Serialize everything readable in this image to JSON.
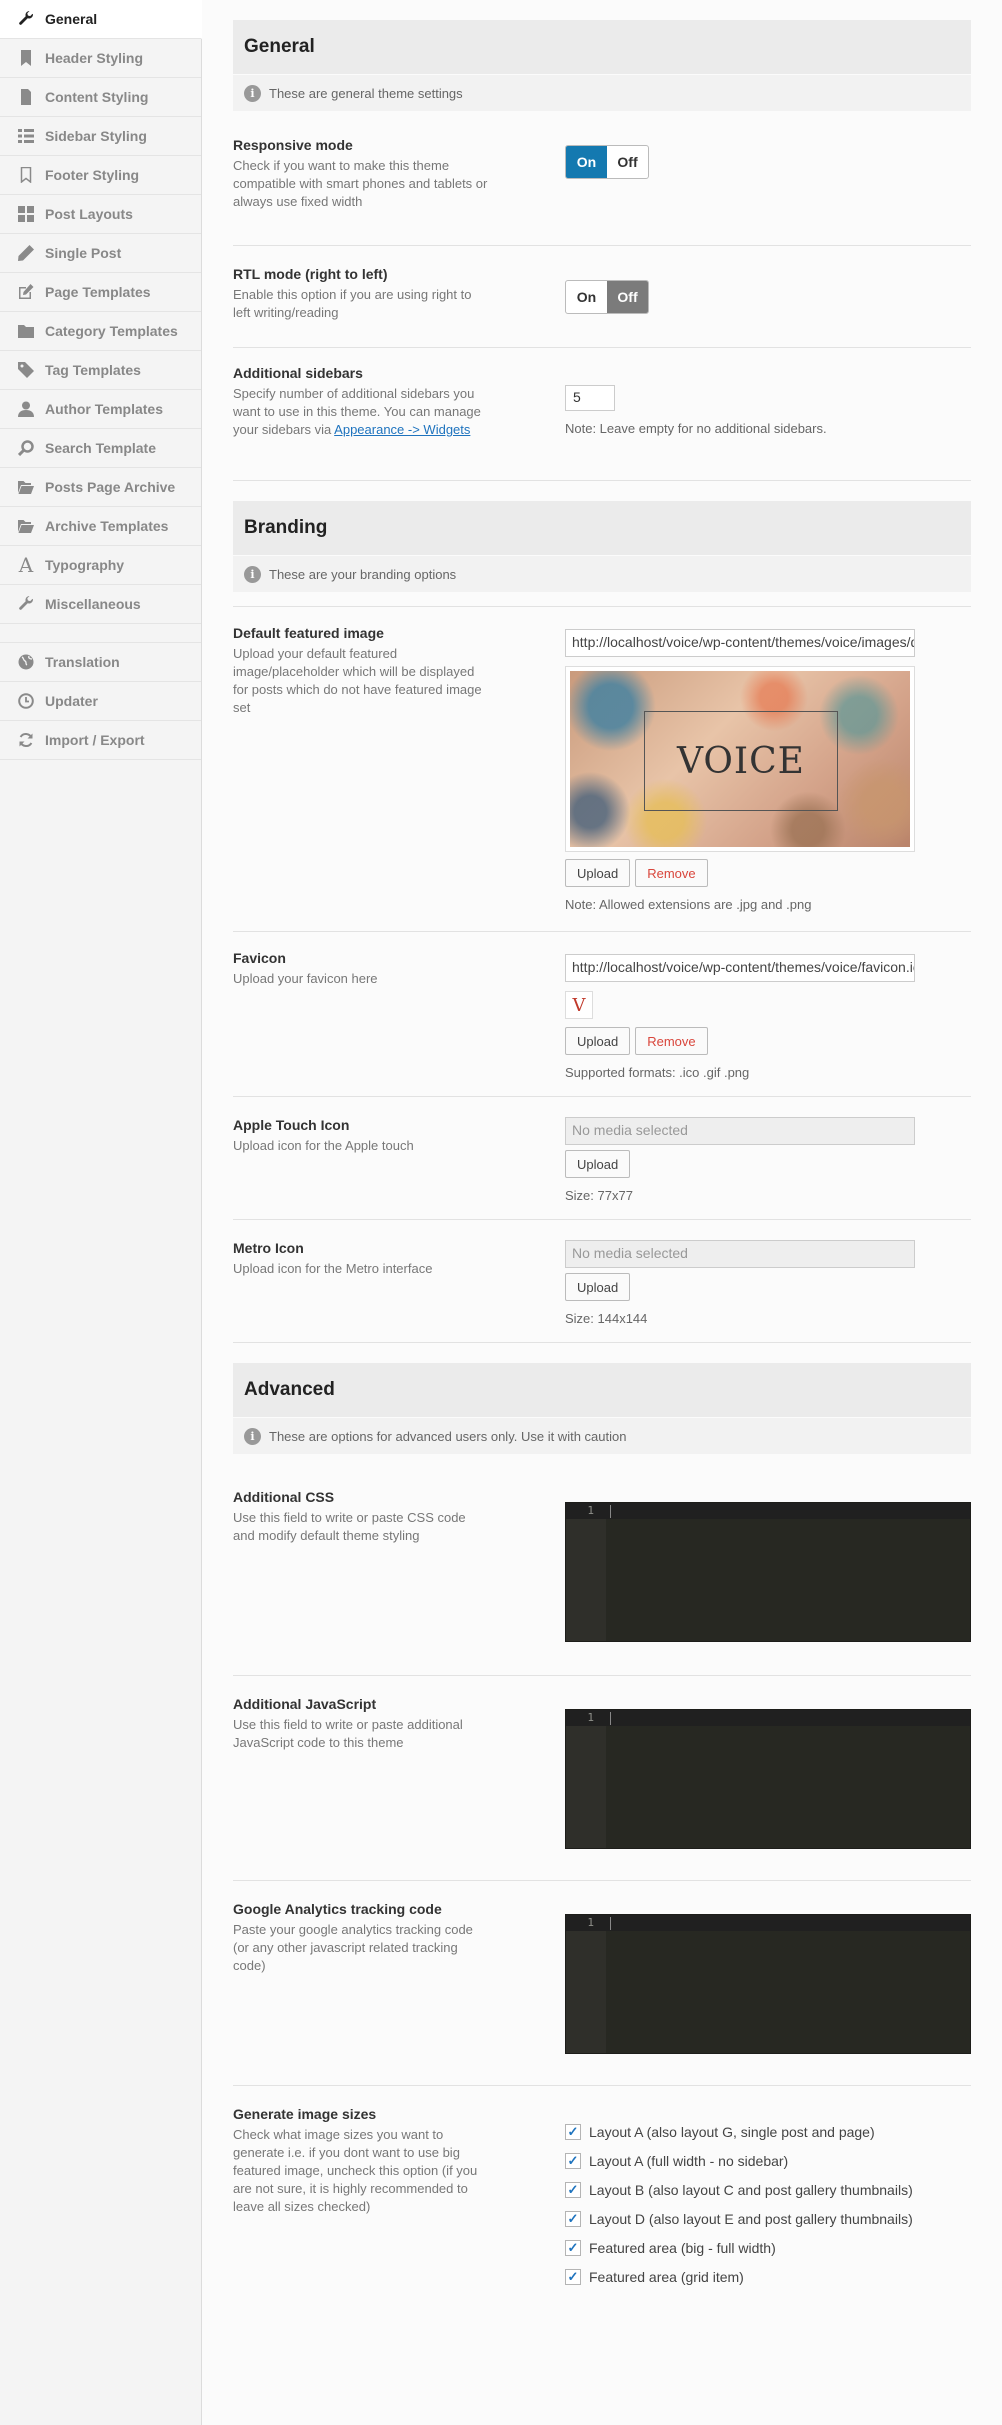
{
  "sidebar": {
    "items": [
      {
        "label": "General",
        "icon": "wrench-icon"
      },
      {
        "label": "Header Styling",
        "icon": "bookmark-icon"
      },
      {
        "label": "Content Styling",
        "icon": "document-icon"
      },
      {
        "label": "Sidebar Styling",
        "icon": "list-icon"
      },
      {
        "label": "Footer Styling",
        "icon": "bookmark-outline-icon"
      },
      {
        "label": "Post Layouts",
        "icon": "grid-icon"
      },
      {
        "label": "Single Post",
        "icon": "pencil-icon"
      },
      {
        "label": "Page Templates",
        "icon": "edit-icon"
      },
      {
        "label": "Category Templates",
        "icon": "folder-icon"
      },
      {
        "label": "Tag Templates",
        "icon": "tag-icon"
      },
      {
        "label": "Author Templates",
        "icon": "user-icon"
      },
      {
        "label": "Search Template",
        "icon": "search-icon"
      },
      {
        "label": "Posts Page Archive",
        "icon": "folder-open-icon"
      },
      {
        "label": "Archive Templates",
        "icon": "folder-open-icon"
      },
      {
        "label": "Typography",
        "icon": "font-icon"
      },
      {
        "label": "Miscellaneous",
        "icon": "wrench-icon"
      },
      {
        "label": "Translation",
        "icon": "globe-icon"
      },
      {
        "label": "Updater",
        "icon": "clock-icon"
      },
      {
        "label": "Import / Export",
        "icon": "refresh-icon"
      }
    ]
  },
  "general": {
    "title": "General",
    "info": "These are general theme settings",
    "responsive": {
      "label": "Responsive mode",
      "desc": "Check if you want to make this theme compatible with smart phones and tablets or always use fixed width",
      "on": "On",
      "off": "Off",
      "value": "On"
    },
    "rtl": {
      "label": "RTL mode (right to left)",
      "desc": "Enable this option if you are using right to left writing/reading",
      "on": "On",
      "off": "Off",
      "value": "Off"
    },
    "sidebars": {
      "label": "Additional sidebars",
      "desc_before": "Specify number of additional sidebars you want to use in this theme. You can manage your sidebars via ",
      "desc_link": "Appearance -> Widgets",
      "value": "5",
      "note": "Note: Leave empty for no additional sidebars."
    }
  },
  "branding": {
    "title": "Branding",
    "info": "These are your branding options",
    "featured": {
      "label": "Default featured image",
      "desc": "Upload your default featured image/placeholder which will be displayed for posts which do not have featured image set",
      "value": "http://localhost/voice/wp-content/themes/voice/images/default.jpg",
      "preview_text": "VOICE",
      "upload": "Upload",
      "remove": "Remove",
      "note": "Note: Allowed extensions are .jpg and .png"
    },
    "favicon": {
      "label": "Favicon",
      "desc": "Upload your favicon here",
      "value": "http://localhost/voice/wp-content/themes/voice/favicon.ico",
      "preview_text": "V",
      "upload": "Upload",
      "remove": "Remove",
      "note": "Supported formats: .ico .gif .png"
    },
    "apple": {
      "label": "Apple Touch Icon",
      "desc": "Upload icon for the Apple touch",
      "placeholder": "No media selected",
      "upload": "Upload",
      "note": "Size: 77x77"
    },
    "metro": {
      "label": "Metro Icon",
      "desc": "Upload icon for the Metro interface",
      "placeholder": "No media selected",
      "upload": "Upload",
      "note": "Size: 144x144"
    }
  },
  "advanced": {
    "title": "Advanced",
    "info": "These are options for advanced users only. Use it with caution",
    "css": {
      "label": "Additional CSS",
      "desc": "Use this field to write or paste CSS code and modify default theme styling",
      "line": "1"
    },
    "js": {
      "label": "Additional JavaScript",
      "desc": "Use this field to write or paste additional JavaScript code to this theme",
      "line": "1"
    },
    "ga": {
      "label": "Google Analytics tracking code",
      "desc": "Paste your google analytics tracking code (or any other javascript related tracking code)",
      "line": "1"
    },
    "image_sizes": {
      "label": "Generate image sizes",
      "desc": "Check what image sizes you want to generate i.e. if you dont want to use big featured image, uncheck this option (if you are not sure, it is highly recommended to leave all sizes checked)",
      "options": [
        {
          "label": "Layout A (also layout G, single post and page)",
          "checked": true
        },
        {
          "label": "Layout A (full width - no sidebar)",
          "checked": true
        },
        {
          "label": "Layout B (also layout C and post gallery thumbnails)",
          "checked": true
        },
        {
          "label": "Layout D (also layout E and post gallery thumbnails)",
          "checked": true
        },
        {
          "label": "Featured area (big - full width)",
          "checked": true
        },
        {
          "label": "Featured area (grid item)",
          "checked": true
        }
      ]
    }
  },
  "colors": {
    "accent": "#1479b0",
    "editor_bg": "#272822",
    "remove": "#d9463c"
  }
}
